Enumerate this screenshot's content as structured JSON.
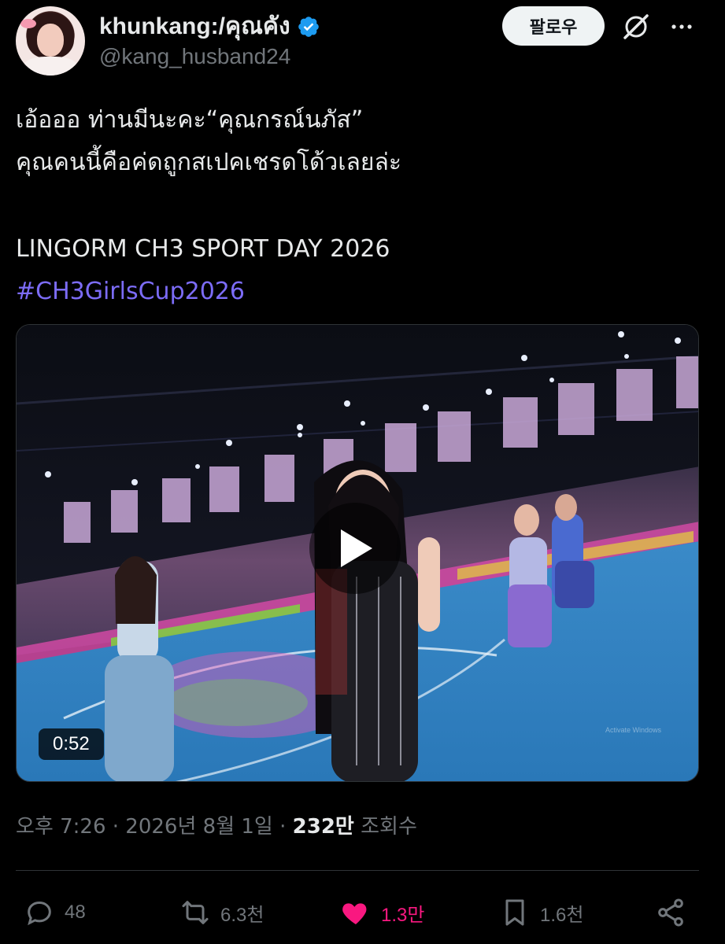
{
  "author": {
    "display_name": "khunkang:/คุณคัง",
    "handle": "@kang_husband24",
    "verified": true
  },
  "header": {
    "follow_label": "팔로우",
    "grok_icon": "grok-icon",
    "more_icon": "more-icon"
  },
  "tweet": {
    "lines": [
      "เอ้อออ ท่านมีนะคะ“คุณกรณ์นภัส”",
      "คุณคนนี้คือค่ดถูกสเปคเชรดโด้วเลยล่ะ",
      "LINGORM CH3 SPORT DAY 2026"
    ],
    "hashtag": "#CH3GirlsCup2026"
  },
  "media": {
    "type": "video",
    "duration": "0:52",
    "play_icon": "play-icon"
  },
  "meta": {
    "time": "오후 7:26",
    "separator": "·",
    "date": "2026년 8월 1일",
    "views_count": "232만",
    "views_label": "조회수"
  },
  "actions": {
    "reply_count": "48",
    "repost_count": "6.3천",
    "like_count": "1.3만",
    "bookmark_count": "1.6천",
    "liked": true
  },
  "colors": {
    "background": "#000000",
    "text": "#e7e9ea",
    "secondary": "#71767b",
    "hashtag": "#7c6cf7",
    "like": "#f91880",
    "verified": "#1d9bf0"
  }
}
